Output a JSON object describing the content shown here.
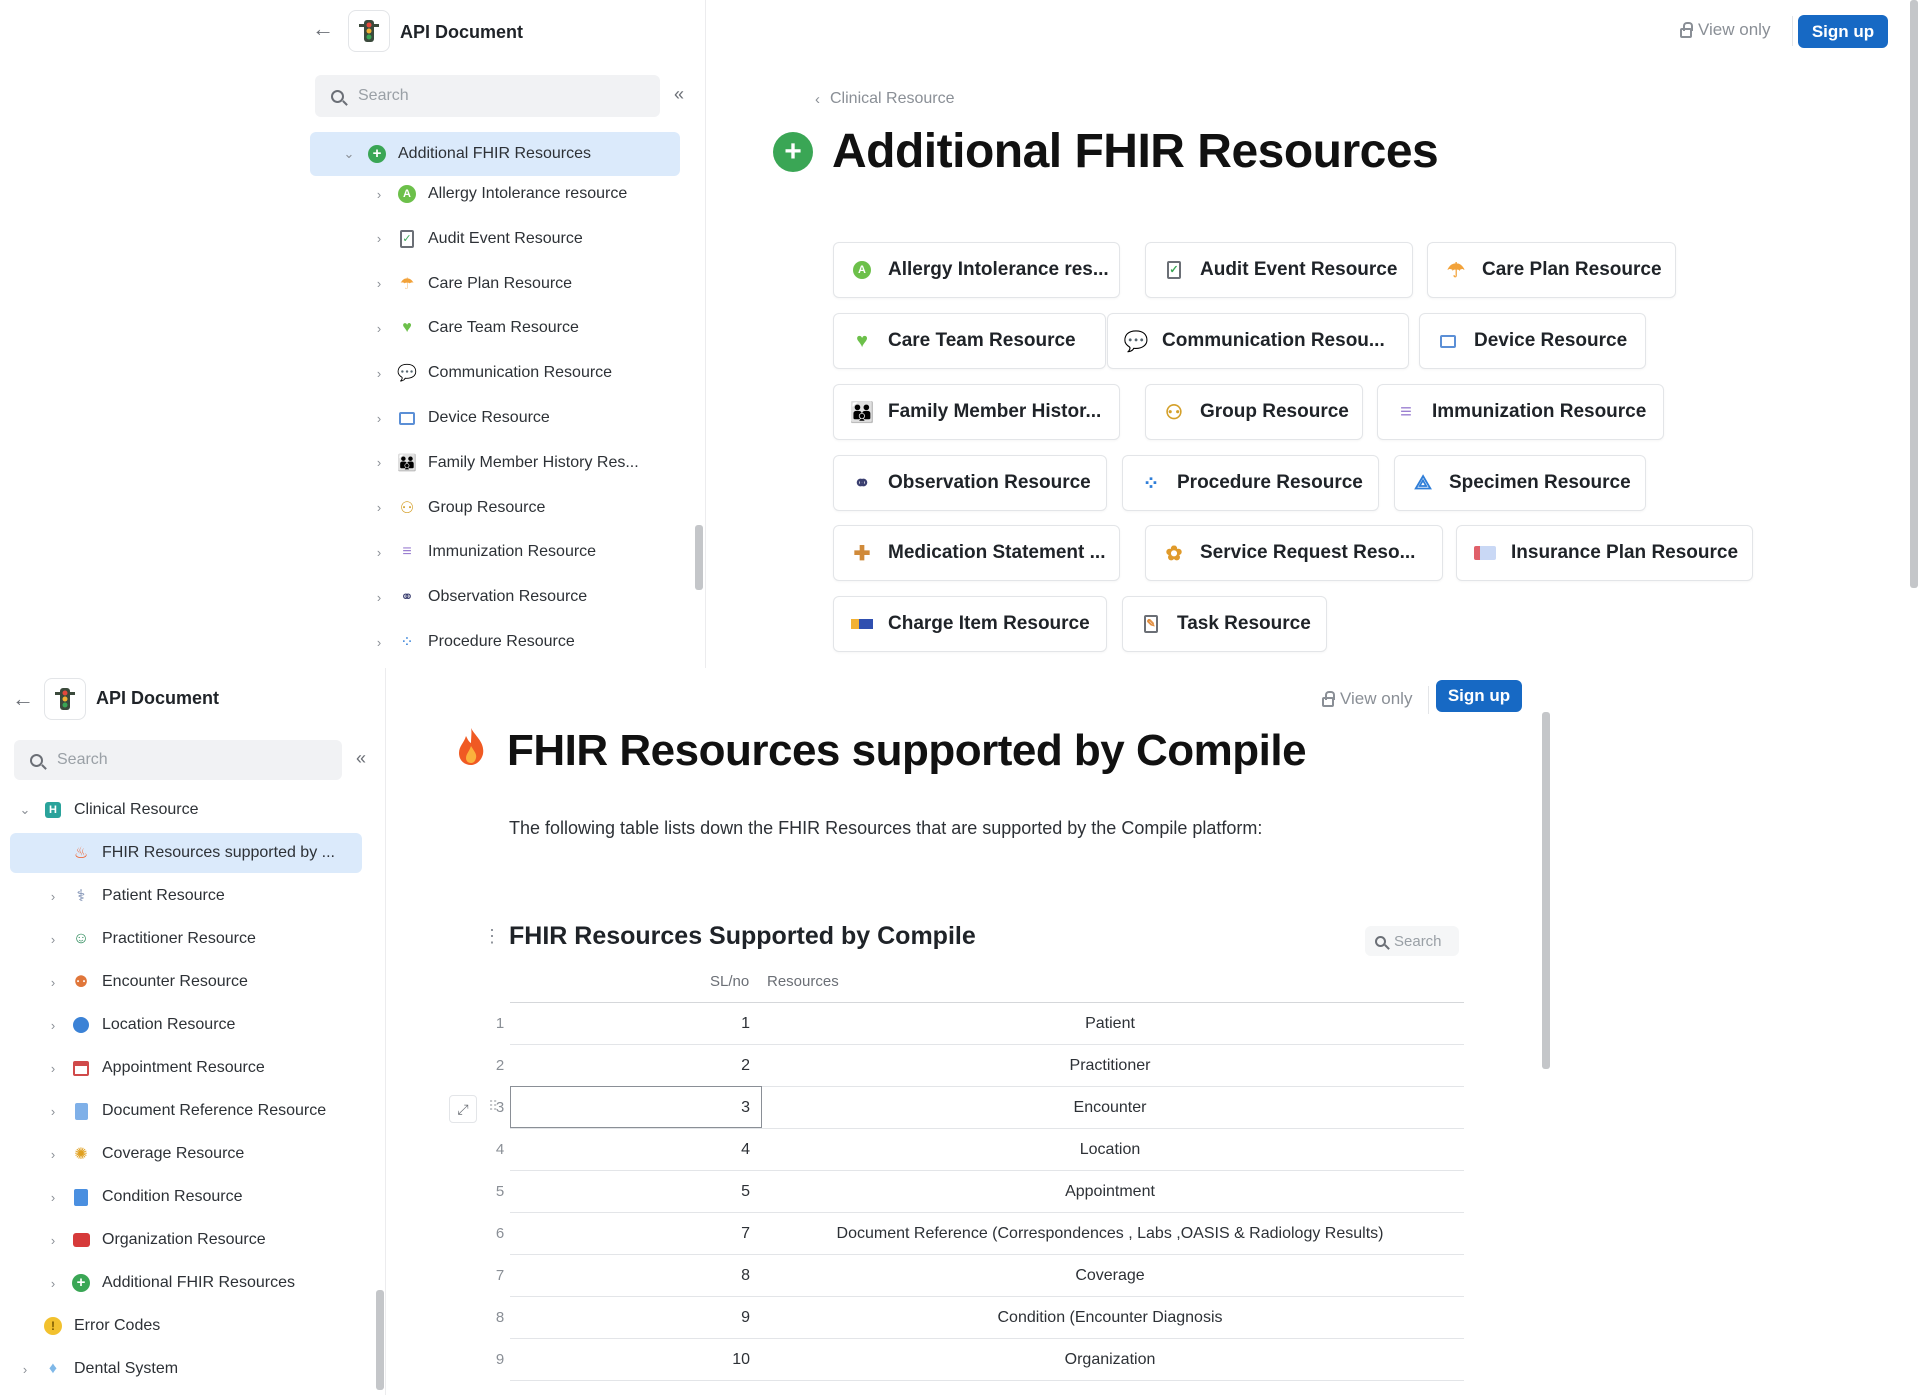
{
  "top": {
    "doc_title": "API Document",
    "search_placeholder": "Search",
    "view_only": "View only",
    "signup": "Sign up",
    "breadcrumb": "Clinical Resource",
    "page_title": "Additional FHIR Resources",
    "nav_items": [
      {
        "label": "Additional FHIR Resources",
        "icon": "plus-circle-icon"
      },
      {
        "label": "Allergy Intolerance resource",
        "icon": "allergy-icon"
      },
      {
        "label": "Audit Event Resource",
        "icon": "clipboard-check-icon"
      },
      {
        "label": "Care Plan Resource",
        "icon": "care-plan-icon"
      },
      {
        "label": "Care Team Resource",
        "icon": "care-team-icon"
      },
      {
        "label": "Communication Resource",
        "icon": "speech-bubbles-icon"
      },
      {
        "label": "Device Resource",
        "icon": "device-icon"
      },
      {
        "label": "Family Member History Res...",
        "icon": "family-icon"
      },
      {
        "label": "Group Resource",
        "icon": "group-icon"
      },
      {
        "label": "Immunization Resource",
        "icon": "immunization-icon"
      },
      {
        "label": "Observation Resource",
        "icon": "binoculars-icon"
      },
      {
        "label": "Procedure Resource",
        "icon": "procedure-icon"
      }
    ],
    "cards": [
      {
        "label": "Allergy Intolerance res...",
        "icon": "allergy-icon"
      },
      {
        "label": "Audit Event Resource",
        "icon": "clipboard-check-icon"
      },
      {
        "label": "Care Plan Resource",
        "icon": "care-plan-icon"
      },
      {
        "label": "Care Team Resource",
        "icon": "care-team-icon"
      },
      {
        "label": "Communication Resou...",
        "icon": "speech-bubbles-icon"
      },
      {
        "label": "Device Resource",
        "icon": "device-icon"
      },
      {
        "label": "Family Member Histor...",
        "icon": "family-icon"
      },
      {
        "label": "Group Resource",
        "icon": "group-icon"
      },
      {
        "label": "Immunization Resource",
        "icon": "immunization-icon"
      },
      {
        "label": "Observation Resource",
        "icon": "binoculars-icon"
      },
      {
        "label": "Procedure Resource",
        "icon": "procedure-icon"
      },
      {
        "label": "Specimen Resource",
        "icon": "specimen-icon"
      },
      {
        "label": "Medication Statement ...",
        "icon": "medication-icon"
      },
      {
        "label": "Service Request Reso...",
        "icon": "service-request-icon"
      },
      {
        "label": "Insurance Plan Resource",
        "icon": "insurance-card-icon"
      },
      {
        "label": "Charge Item Resource",
        "icon": "charge-item-icon"
      },
      {
        "label": "Task Resource",
        "icon": "task-icon"
      }
    ]
  },
  "bottom": {
    "doc_title": "API Document",
    "search_placeholder": "Search",
    "view_only": "View only",
    "signup": "Sign up",
    "page_title": "FHIR Resources supported by Compile",
    "intro": "The following table lists down the FHIR Resources that are supported by the Compile platform:",
    "table_title": "FHIR Resources Supported by Compile",
    "table_search": "Search",
    "col_sl": "SL/no",
    "col_res": "Resources",
    "nav_items": [
      {
        "label": "Clinical Resource",
        "icon": "hospital-icon"
      },
      {
        "label": "FHIR Resources supported by ...",
        "icon": "fire-icon"
      },
      {
        "label": "Patient Resource",
        "icon": "patient-icon"
      },
      {
        "label": "Practitioner Resource",
        "icon": "practitioner-icon"
      },
      {
        "label": "Encounter Resource",
        "icon": "encounter-icon"
      },
      {
        "label": "Location Resource",
        "icon": "globe-icon"
      },
      {
        "label": "Appointment Resource",
        "icon": "calendar-icon"
      },
      {
        "label": "Document Reference Resource",
        "icon": "document-icon"
      },
      {
        "label": "Coverage Resource",
        "icon": "coverage-icon"
      },
      {
        "label": "Condition Resource",
        "icon": "condition-icon"
      },
      {
        "label": "Organization Resource",
        "icon": "briefcase-icon"
      },
      {
        "label": "Additional FHIR Resources",
        "icon": "plus-circle-icon"
      },
      {
        "label": "Error Codes",
        "icon": "warning-icon"
      },
      {
        "label": "Dental System",
        "icon": "tooth-icon"
      }
    ],
    "rows": [
      {
        "n": "1",
        "sl": "1",
        "res": "Patient"
      },
      {
        "n": "2",
        "sl": "2",
        "res": "Practitioner"
      },
      {
        "n": "3",
        "sl": "3",
        "res": "Encounter"
      },
      {
        "n": "4",
        "sl": "4",
        "res": "Location"
      },
      {
        "n": "5",
        "sl": "5",
        "res": "Appointment"
      },
      {
        "n": "6",
        "sl": "7",
        "res": "Document Reference (Correspondences , Labs ,OASIS & Radiology Results)"
      },
      {
        "n": "7",
        "sl": "8",
        "res": "Coverage"
      },
      {
        "n": "8",
        "sl": "9",
        "res": "Condition (Encounter Diagnosis"
      },
      {
        "n": "9",
        "sl": "10",
        "res": "Organization"
      }
    ]
  },
  "colors": {
    "accent": "#1769c4",
    "active_bg": "#dbeafb",
    "green": "#3aa655"
  }
}
